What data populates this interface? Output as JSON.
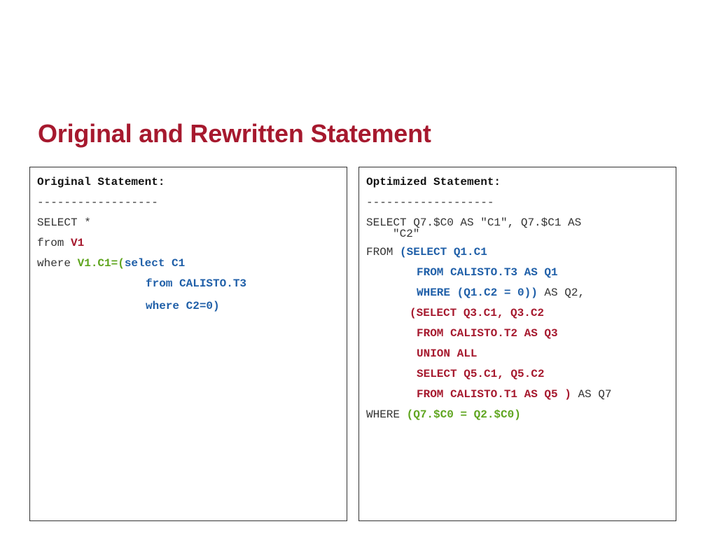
{
  "title": "Original and Rewritten Statement",
  "original": {
    "header": "Original Statement:",
    "dashes": "------------------",
    "line1": "SELECT *",
    "line2_kw": "from ",
    "line2_val": "V1",
    "line3_kw": "where ",
    "line3_cond": "V1.C1=(",
    "line3_sub": "select C1",
    "line4": "from CALISTO.T3",
    "line5": "where C2=0)"
  },
  "optimized": {
    "header": "Optimized Statement:",
    "dashes": "-------------------",
    "line1": "SELECT Q7.$C0 AS \"C1\", Q7.$C1 AS",
    "line1_wrap": "\"C2\"",
    "from_kw": "FROM ",
    "from_sub1": "(SELECT Q1.C1",
    "from_sub2": "FROM CALISTO.T3 AS Q1",
    "from_sub3": "WHERE (Q1.C2 = 0))",
    "from_sub3_tail": " AS Q2,",
    "union1": "(SELECT Q3.C1, Q3.C2",
    "union2": "FROM CALISTO.T2 AS Q3",
    "union3": "UNION ALL",
    "union4": "SELECT Q5.C1, Q5.C2",
    "union5": "FROM CALISTO.T1 AS Q5 )",
    "union5_tail": " AS Q7",
    "where_kw": "WHERE ",
    "where_cond": "(Q7.$C0 = Q2.$C0)"
  }
}
